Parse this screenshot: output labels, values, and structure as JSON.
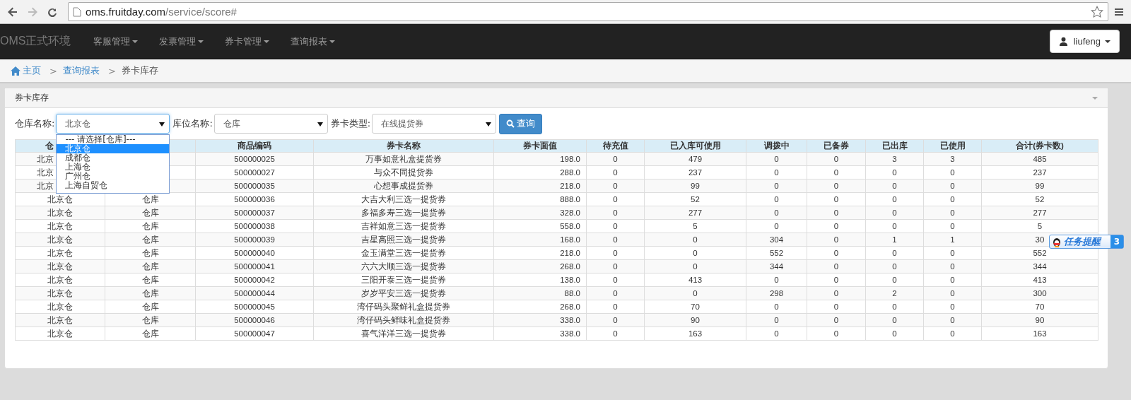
{
  "browser": {
    "url": {
      "host": "oms.fruitday.com",
      "path": "/service/score#"
    }
  },
  "navbar": {
    "brand": "OMS正式环境",
    "menus": [
      "客服管理",
      "发票管理",
      "券卡管理",
      "查询报表"
    ],
    "user": "liufeng"
  },
  "breadcrumb": [
    {
      "label": "主页",
      "kind": "home"
    },
    {
      "label": "查询报表",
      "kind": "link",
      "separator": ">"
    },
    {
      "label": "券卡库存",
      "kind": "current",
      "separator": ">"
    }
  ],
  "panel": {
    "title": "券卡库存",
    "filters": [
      {
        "label": "仓库名称:",
        "value": "北京仓",
        "focused": true
      },
      {
        "label": "库位名称:",
        "value": "仓库",
        "focused": false
      },
      {
        "label": "券卡类型:",
        "value": "在线提货券",
        "focused": false
      }
    ],
    "query_button": "查询",
    "dropdown": [
      {
        "label": "--- 请选择[仓库]---",
        "selected": false
      },
      {
        "label": "北京仓",
        "selected": true
      },
      {
        "label": "成都仓",
        "selected": false
      },
      {
        "label": "上海仓",
        "selected": false
      },
      {
        "label": "广州仓",
        "selected": false
      },
      {
        "label": "上海自贸仓",
        "selected": false
      }
    ],
    "table": {
      "columns": [
        "仓",
        null,
        "商品编码",
        "券卡名称",
        "券卡面值",
        "待充值",
        "已入库可使用",
        "调拨中",
        "已备券",
        "已出库",
        "已使用",
        "合计(券卡数)"
      ],
      "rows": [
        {
          "cells": [
            "北京",
            null,
            "500000025",
            "万事如意礼盒提货券",
            "198.0",
            "0",
            "479",
            "0",
            "0",
            "3",
            "3",
            "485"
          ]
        },
        {
          "cells": [
            "北京",
            null,
            "500000027",
            "与众不同提货券",
            "288.0",
            "0",
            "237",
            "0",
            "0",
            "0",
            "0",
            "237"
          ]
        },
        {
          "cells": [
            "北京",
            null,
            "500000035",
            "心想事成提货券",
            "218.0",
            "0",
            "99",
            "0",
            "0",
            "0",
            "0",
            "99"
          ]
        },
        {
          "cells": [
            "北京仓",
            "仓库",
            "500000036",
            "大吉大利三选一提货券",
            "888.0",
            "0",
            "52",
            "0",
            "0",
            "0",
            "0",
            "52"
          ]
        },
        {
          "cells": [
            "北京仓",
            "仓库",
            "500000037",
            "多福多寿三选一提货券",
            "328.0",
            "0",
            "277",
            "0",
            "0",
            "0",
            "0",
            "277"
          ]
        },
        {
          "cells": [
            "北京仓",
            "仓库",
            "500000038",
            "吉祥如意三选一提货券",
            "558.0",
            "0",
            "5",
            "0",
            "0",
            "0",
            "0",
            "5"
          ]
        },
        {
          "cells": [
            "北京仓",
            "仓库",
            "500000039",
            "吉星高照三选一提货券",
            "168.0",
            "0",
            "0",
            "304",
            "0",
            "1",
            "1",
            "30"
          ]
        },
        {
          "cells": [
            "北京仓",
            "仓库",
            "500000040",
            "金玉满堂三选一提货券",
            "218.0",
            "0",
            "0",
            "552",
            "0",
            "0",
            "0",
            "552"
          ]
        },
        {
          "cells": [
            "北京仓",
            "仓库",
            "500000041",
            "六六大顺三选一提货券",
            "268.0",
            "0",
            "0",
            "344",
            "0",
            "0",
            "0",
            "344"
          ]
        },
        {
          "cells": [
            "北京仓",
            "仓库",
            "500000042",
            "三阳开泰三选一提货券",
            "138.0",
            "0",
            "413",
            "0",
            "0",
            "0",
            "0",
            "413"
          ]
        },
        {
          "cells": [
            "北京仓",
            "仓库",
            "500000044",
            "岁岁平安三选一提货券",
            "88.0",
            "0",
            "0",
            "298",
            "0",
            "2",
            "0",
            "300"
          ]
        },
        {
          "cells": [
            "北京仓",
            "仓库",
            "500000045",
            "湾仔码头聚鲜礼盒提货券",
            "268.0",
            "0",
            "70",
            "0",
            "0",
            "0",
            "0",
            "70"
          ]
        },
        {
          "cells": [
            "北京仓",
            "仓库",
            "500000046",
            "湾仔码头鲜味礼盒提货券",
            "338.0",
            "0",
            "90",
            "0",
            "0",
            "0",
            "0",
            "90"
          ]
        },
        {
          "cells": [
            "北京仓",
            "仓库",
            "500000047",
            "喜气洋洋三选一提货券",
            "338.0",
            "0",
            "163",
            "0",
            "0",
            "0",
            "0",
            "163"
          ]
        }
      ]
    }
  },
  "task_reminder": {
    "label": "任务提醒",
    "count": "3"
  }
}
